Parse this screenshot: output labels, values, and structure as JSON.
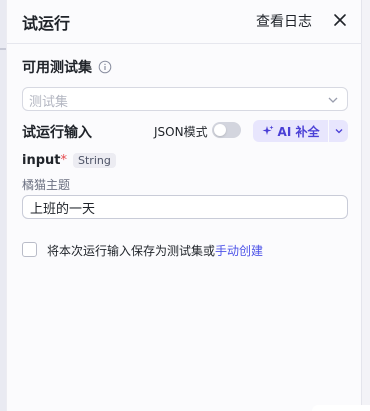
{
  "header": {
    "title": "试运行",
    "view_logs": "查看日志",
    "close_icon": "close-icon"
  },
  "test_set": {
    "label": "可用测试集",
    "info_icon": "info-icon",
    "select_placeholder": "测试集"
  },
  "run_input": {
    "label": "试运行输入",
    "json_mode_label": "JSON模式",
    "json_mode_on": false,
    "ai_button_label": "AI 补全",
    "ai_icon": "sparkle-icon",
    "ai_dropdown_icon": "chevron-down-icon"
  },
  "param": {
    "name": "input",
    "required_mark": "*",
    "type": "String",
    "description": "橘猫主题",
    "value": "上班的一天"
  },
  "save": {
    "checked": false,
    "text": "将本次运行输入保存为测试集或",
    "link": "手动创建"
  },
  "colors": {
    "accent": "#4d53e8",
    "ai_bg": "#e8e6fd",
    "required": "#e5484d"
  }
}
